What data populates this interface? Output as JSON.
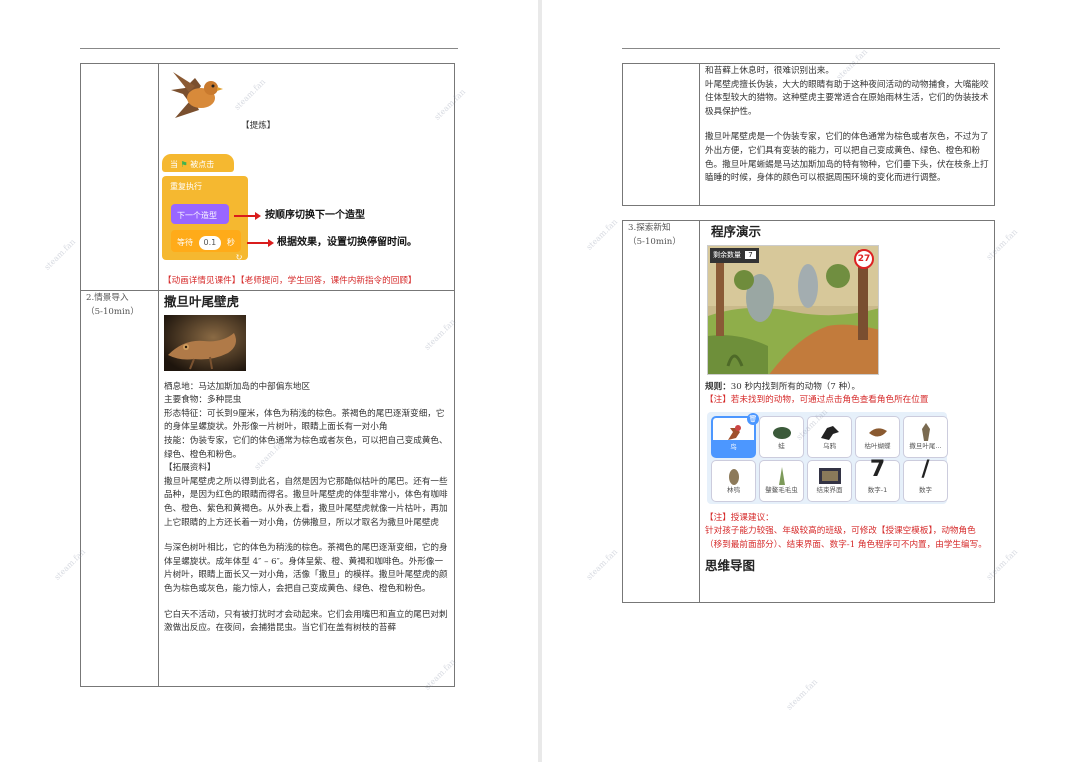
{
  "left_page": {
    "row1": {
      "caption": "【提炼】",
      "blocks": {
        "when_flag": "当",
        "when_flag_tail": "被点击",
        "forever": "重复执行",
        "next_costume": "下一个造型",
        "wait": "等待",
        "wait_value": "0.1",
        "wait_unit": "秒"
      },
      "annotations": [
        "按顺序切换下一个造型",
        "根据效果，设置切换停留时间。"
      ],
      "note": "【动画详情见课件】【老师提问，学生回答，课件内新指令的回顾】"
    },
    "row2": {
      "left": [
        "2.情景导入",
        "（5-10min）"
      ],
      "heading": "撒旦叶尾壁虎",
      "lines": [
        "栖息地：马达加斯加岛的中部偏东地区",
        "主要食物：多种昆虫",
        "形态特征：可长到9厘米，体色为稍浅的棕色。茶褐色的尾巴逐渐变细，它的身体呈螺旋状。外形像一片树叶，眼睛上面长有一对小角",
        "技能：伪装专家，它们的体色通常为棕色或者灰色，可以把自己变成黄色、绿色、橙色和粉色。",
        "【拓展资料】",
        "撒旦叶尾壁虎之所以得到此名，自然是因为它那酷似枯叶的尾巴。还有一些品种，是因为红色的眼睛而得名。撒旦叶尾壁虎的体型非常小，体色有咖啡色、橙色、紫色和黄褐色。从外表上看，撒旦叶尾壁虎就像一片枯叶，再加上它眼睛的上方还长着一对小角，仿佛撒旦，所以才取名为撒旦叶尾壁虎"
      ],
      "para2": "与深色树叶相比，它的体色为稍浅的棕色。茶褐色的尾巴逐渐变细，它的身体呈螺旋状。成年体型 4″ – 6″。身体呈紫、橙、黄褐和咖啡色。外形像一片树叶，眼睛上面长又一对小角，活像「撒旦」的模样。撒旦叶尾壁虎的颜色为棕色或灰色，能力惊人，会把自己变成黄色、绿色、橙色和粉色。",
      "para3": "它白天不活动，只有被打扰时才会动起来。它们会用嘴巴和直立的尾巴对刺激做出反应。在夜间，会捕猎昆虫。当它们在盖有树枝的苔藓"
    }
  },
  "right_page": {
    "row1": {
      "lines": [
        "和苔藓上休息时，很难识别出来。",
        "叶尾壁虎擅长伪装，大大的眼睛有助于这种夜间活动的动物捕食，大嘴能咬住体型较大的猎物。这种壁虎主要常适合在原始雨林生活，它们的伪装技术极具保护性。"
      ],
      "para2": "撒旦叶尾壁虎是一个伪装专家，它们的体色通常为棕色或者灰色，不过为了外出方便，它们具有变装的能力，可以把自己变成黄色、绿色、橙色和粉色。撒旦叶尾蜥蜴是马达加斯加岛的特有物种，它们垂下头，伏在枝条上打瞌睡的时候，身体的颜色可以根据周围环境的变化而进行调整。"
    },
    "row2": {
      "left": [
        "3.探索新知",
        "（5-10min）"
      ],
      "heading": "程序演示",
      "game": {
        "score_label": "剩余数量",
        "score_value": "7",
        "timer": "27"
      },
      "rule_label": "规则：",
      "rule_text": "30 秒内找到所有的动物（7 种）。",
      "note1": "【注】若未找到的动物，可通过点击角色查看角色所在位置",
      "sprites": [
        "鸟",
        "蛙",
        "乌鸦",
        "枯叶蝴蝶",
        "撒旦叶尾...",
        "林鸮",
        "躄鳌毛毛虫",
        "结束界面",
        "数字-1",
        "数字"
      ],
      "note2_title": "【注】授课建议：",
      "note2_text": "针对孩子能力较强、年级较高的班级，可修改【授课空模板】，动物角色（移到最前面部分）、结束界面、数字-1 角色程序可不内置，由学生编写。",
      "mindmap": "思维导图"
    }
  },
  "watermark": "steam.fan"
}
